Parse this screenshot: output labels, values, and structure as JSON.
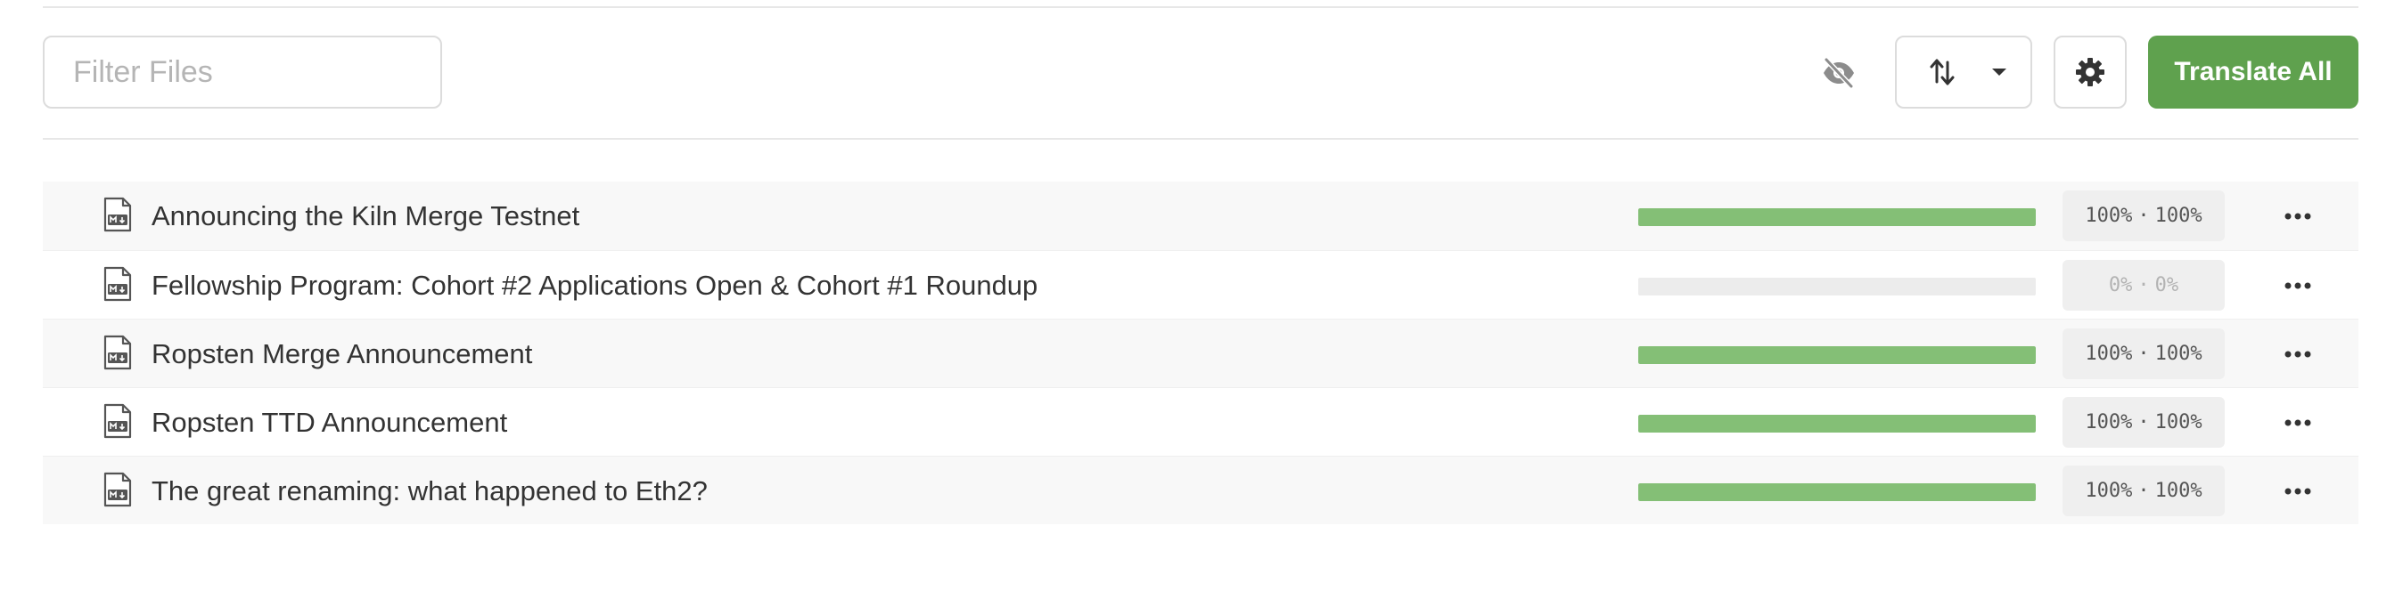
{
  "toolbar": {
    "filter_placeholder": "Filter Files",
    "hidden_toggle_icon": "eye-slash-icon",
    "sort_icon": "sort-arrows-icon",
    "settings_icon": "gear-icon",
    "translate_all_label": "Translate All"
  },
  "colors": {
    "accent": "#5fa14e",
    "progress": "#84bf76",
    "track": "#ececec"
  },
  "files": [
    {
      "title": "Announcing the Kiln Merge Testnet",
      "progress": 100,
      "translated": "100%",
      "approved": "100%",
      "sep": "·"
    },
    {
      "title": "Fellowship Program: Cohort #2 Applications Open & Cohort #1 Roundup",
      "progress": 0,
      "translated": "0%",
      "approved": "0%",
      "sep": "·"
    },
    {
      "title": "Ropsten Merge Announcement",
      "progress": 100,
      "translated": "100%",
      "approved": "100%",
      "sep": "·"
    },
    {
      "title": "Ropsten TTD Announcement",
      "progress": 100,
      "translated": "100%",
      "approved": "100%",
      "sep": "·"
    },
    {
      "title": "The great renaming: what happened to Eth2?",
      "progress": 100,
      "translated": "100%",
      "approved": "100%",
      "sep": "·"
    }
  ]
}
